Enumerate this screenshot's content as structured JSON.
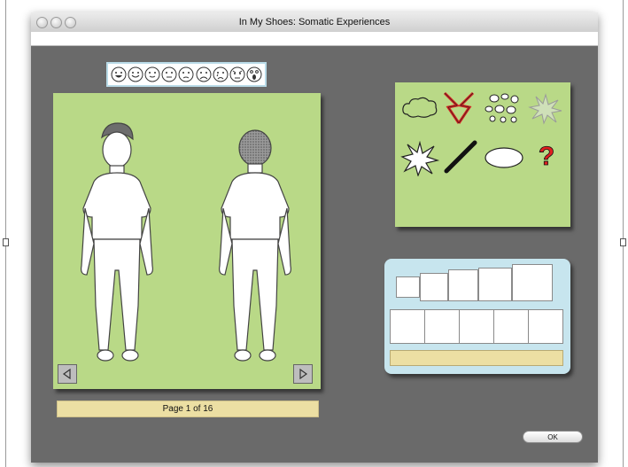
{
  "window": {
    "title": "In My Shoes: Somatic Experiences"
  },
  "emotions": {
    "icons": [
      "very-happy-face-icon",
      "happy-face-icon",
      "smile-face-icon",
      "neutral-face-icon",
      "slightly-sad-face-icon",
      "sad-face-icon",
      "crying-face-icon",
      "angry-face-icon",
      "scared-face-icon"
    ]
  },
  "body_panel": {
    "figures": [
      "front-view-body-figure",
      "back-view-body-figure"
    ],
    "prev_icon": "left-arrow-icon",
    "next_icon": "right-arrow-icon"
  },
  "pager": {
    "label": "Page 1 of 16"
  },
  "symbols": {
    "items": [
      "cloud-icon",
      "lightning-burst-icon",
      "bubbles-icon",
      "sparkle-burst-icon",
      "star-burst-icon",
      "line-stroke-icon",
      "oval-icon",
      "question-mark-icon"
    ],
    "question_glyph": "?"
  },
  "size_panel": {
    "field_value": ""
  },
  "buttons": {
    "ok": "OK"
  },
  "colors": {
    "window_bg": "#6a6a6a",
    "panel_green": "#b9d987",
    "panel_blue": "#c7e5ee",
    "field_yellow": "#ecdfa3",
    "question_red": "#e02020"
  }
}
